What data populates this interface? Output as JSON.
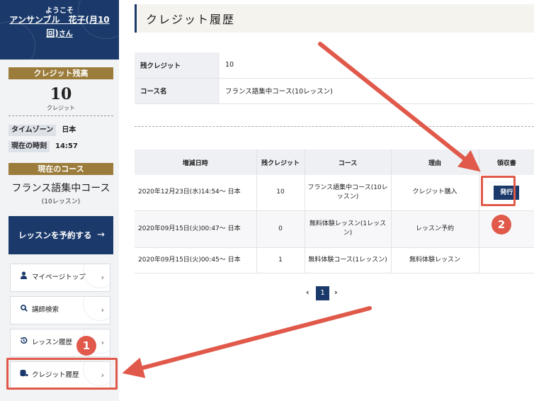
{
  "sidebar": {
    "welcome": "ようこそ",
    "user_name": "アンサンブル　花子(月10回)",
    "user_suffix": "さん",
    "credit_heading": "クレジット残高",
    "credit_value": "10",
    "credit_unit": "クレジット",
    "timezone_label": "タイムゾーン",
    "timezone_value": "日本",
    "time_label": "現在の時刻",
    "time_value": "14:57",
    "course_heading": "現在のコース",
    "course_name": "フランス語集中コース",
    "course_lessons": "(10レッスン)",
    "book_button": "レッスンを予約する",
    "book_arrow": "→",
    "nav": [
      {
        "label": "マイページトップ",
        "icon": "user-icon"
      },
      {
        "label": "講師検索",
        "icon": "search-icon"
      },
      {
        "label": "レッスン履歴",
        "icon": "history-icon"
      },
      {
        "label": "クレジット履歴",
        "icon": "coins-icon"
      }
    ],
    "chevron": "›"
  },
  "main": {
    "page_title": "クレジット履歴",
    "info": {
      "remaining_label": "残クレジット",
      "remaining_value": "10",
      "course_label": "コース名",
      "course_value": "フランス語集中コース(10レッスン)"
    },
    "history": {
      "headers": [
        "増減日時",
        "残クレジット",
        "コース",
        "理由",
        "領収書"
      ],
      "rows": [
        {
          "date": "2020年12月23日(水)14:54～ 日本",
          "credits": "10",
          "course": "フランス語集中コース(10レッスン)",
          "reason": "クレジット購入",
          "receipt": "発行"
        },
        {
          "date": "2020年09月15日(火)00:47～ 日本",
          "credits": "0",
          "course": "無料体験レッスン(1レッスン)",
          "reason": "レッスン予約",
          "receipt": ""
        },
        {
          "date": "2020年09月15日(火)00:45～ 日本",
          "credits": "1",
          "course": "無料体験コース(1レッスン)",
          "reason": "無料体験レッスン",
          "receipt": ""
        }
      ]
    },
    "pager": {
      "prev": "‹",
      "current": "1",
      "next": "›"
    }
  },
  "annotations": {
    "badge_1": "1",
    "badge_2": "2",
    "color": "#e0594a"
  },
  "colors": {
    "navy": "#1b3a6b",
    "gold": "#9b7c3a",
    "highlight": "#e0594a"
  }
}
